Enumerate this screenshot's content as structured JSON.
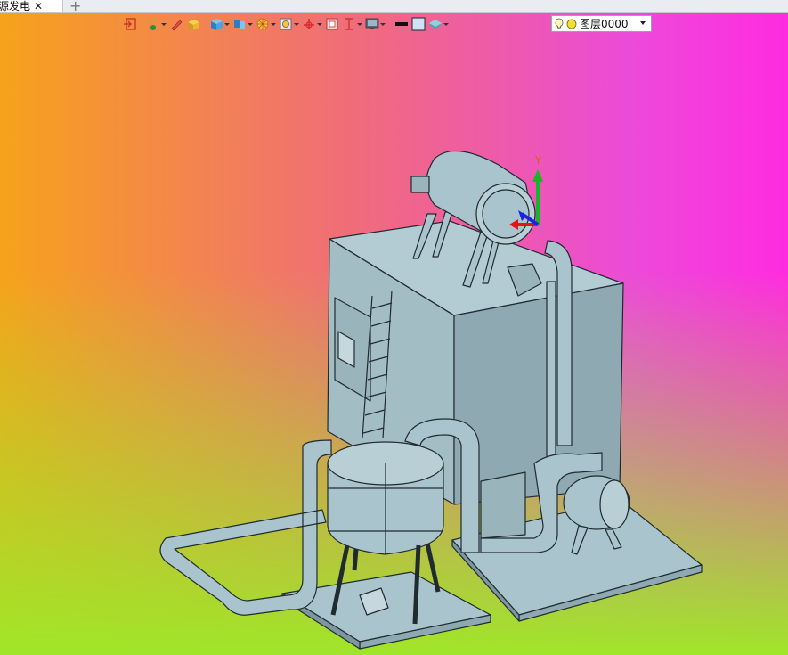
{
  "tab": {
    "title": "源发电",
    "close_glyph": "✕",
    "add_glyph": "+"
  },
  "toolbar": {
    "items": [
      {
        "icon": "exit-view-icon",
        "caret": false
      },
      {
        "icon": "render-mode-icon",
        "caret": true
      },
      {
        "icon": "pen-icon",
        "caret": false
      },
      {
        "icon": "solid-box-icon",
        "caret": false
      },
      {
        "icon": "blue-cube-icon",
        "caret": true
      },
      {
        "icon": "view-orientation-icon",
        "caret": true
      },
      {
        "icon": "section-wheel-icon",
        "caret": true
      },
      {
        "icon": "zoom-fit-icon",
        "caret": true
      },
      {
        "icon": "coordinate-axis-icon",
        "caret": true
      },
      {
        "icon": "frame-icon",
        "caret": false
      },
      {
        "icon": "measure-icon",
        "caret": true
      },
      {
        "icon": "monitor-icon",
        "caret": true
      },
      {
        "icon": "line-color-icon",
        "caret": false
      },
      {
        "icon": "fill-color-icon",
        "caret": false
      },
      {
        "icon": "layer-stack-icon",
        "caret": true
      }
    ]
  },
  "layer": {
    "name": "图层0000",
    "bulb_icon": "lightbulb-icon",
    "dot_icon": "layer-status-dot-icon"
  },
  "colors": {
    "model": "#a9c4cc",
    "model_shade": "#8fa9b2",
    "model_dark": "#7d96a0",
    "outline": "#1f2b2f",
    "axis_x": "#e01515",
    "axis_y": "#17b52a",
    "axis_z": "#1727e0",
    "axis_label": "#e05a10"
  },
  "axis": {
    "y_label": "Y"
  }
}
